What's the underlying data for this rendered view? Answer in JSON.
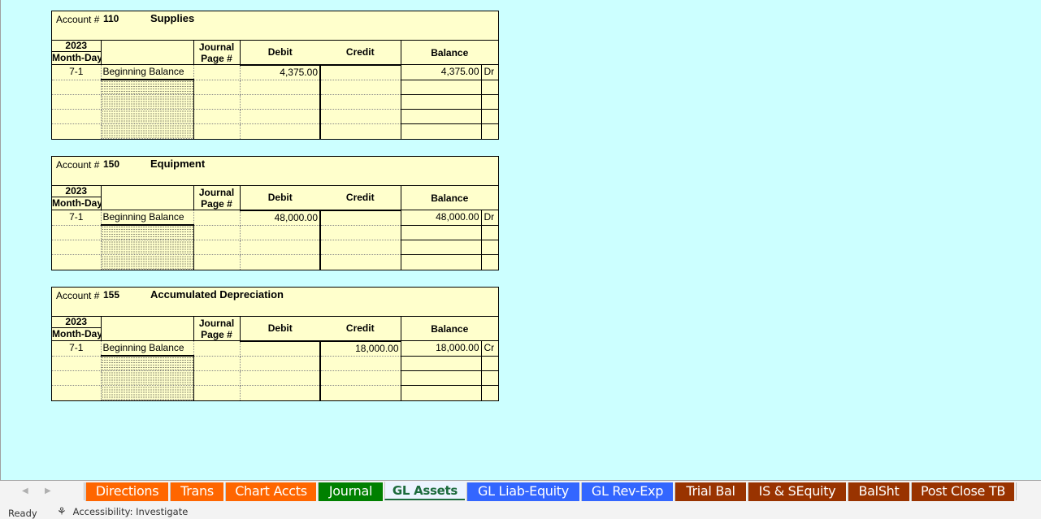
{
  "ledger_header": {
    "account_label": "Account #",
    "year": "2023",
    "month_day": "Month-Day",
    "journal_line1": "Journal",
    "journal_line2": "Page #",
    "debit": "Debit",
    "credit": "Credit",
    "balance": "Balance"
  },
  "accounts": [
    {
      "number": "110",
      "name": "Supplies",
      "entries": [
        {
          "date": "7-1",
          "description": "Beginning Balance",
          "journal": "",
          "debit": "4,375.00",
          "credit": "",
          "balance": "4,375.00",
          "side": "Dr"
        }
      ]
    },
    {
      "number": "150",
      "name": "Equipment",
      "entries": [
        {
          "date": "7-1",
          "description": "Beginning Balance",
          "journal": "",
          "debit": "48,000.00",
          "credit": "",
          "balance": "48,000.00",
          "side": "Dr"
        }
      ]
    },
    {
      "number": "155",
      "name": "Accumulated Depreciation",
      "entries": [
        {
          "date": "7-1",
          "description": "Beginning Balance",
          "journal": "",
          "debit": "",
          "credit": "18,000.00",
          "balance": "18,000.00",
          "side": "Cr"
        }
      ]
    }
  ],
  "tabs": [
    {
      "label": "Directions",
      "color": "#ff6600",
      "active": false
    },
    {
      "label": "Trans",
      "color": "#ff6600",
      "active": false
    },
    {
      "label": "Chart Accts",
      "color": "#ff6600",
      "active": false
    },
    {
      "label": "Journal",
      "color": "#008000",
      "active": false
    },
    {
      "label": "GL Assets",
      "color": "#ecf4ff",
      "active": true
    },
    {
      "label": "GL Liab-Equity",
      "color": "#3366ff",
      "active": false
    },
    {
      "label": "GL Rev-Exp",
      "color": "#3366ff",
      "active": false
    },
    {
      "label": "Trial Bal",
      "color": "#993300",
      "active": false
    },
    {
      "label": "IS & SEquity",
      "color": "#993300",
      "active": false
    },
    {
      "label": "BalSht",
      "color": "#993300",
      "active": false
    },
    {
      "label": "Post Close TB",
      "color": "#993300",
      "active": false
    }
  ],
  "status": {
    "ready": "Ready",
    "accessibility": "Accessibility: Investigate"
  },
  "colors": {
    "sheet_bg": "#ccffff",
    "ledger_bg": "#ffffcc"
  }
}
